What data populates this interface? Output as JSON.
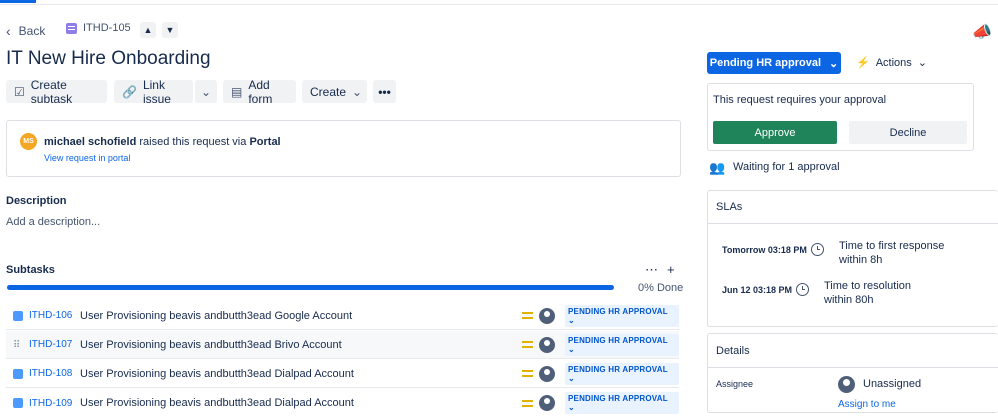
{
  "header": {
    "back_label": "Back",
    "issue_key": "ITHD-105",
    "title": "IT New Hire Onboarding"
  },
  "toolbar": {
    "create_subtask": "Create subtask",
    "link_issue": "Link issue",
    "add_form": "Add form",
    "create": "Create"
  },
  "request": {
    "reporter": "michael schofield",
    "reporter_initials": "MS",
    "raised_text": "raised this request via",
    "channel": "Portal",
    "view_link": "View request in portal"
  },
  "description": {
    "heading": "Description",
    "placeholder": "Add a description..."
  },
  "subtasks": {
    "heading": "Subtasks",
    "progress_percent": 0,
    "progress_label": "0% Done",
    "items": [
      {
        "key": "ITHD-106",
        "summary": "User Provisioning beavis andbutth3ead Google Account",
        "status": "PENDING HR APPROVAL"
      },
      {
        "key": "ITHD-107",
        "summary": "User Provisioning beavis andbutth3ead Brivo Account",
        "status": "PENDING HR APPROVAL"
      },
      {
        "key": "ITHD-108",
        "summary": "User Provisioning beavis andbutth3ead Dialpad Account",
        "status": "PENDING HR APPROVAL"
      },
      {
        "key": "ITHD-109",
        "summary": "User Provisioning beavis andbutth3ead Dialpad Account",
        "status": "PENDING HR APPROVAL"
      }
    ]
  },
  "sidebar": {
    "status_button": "Pending HR approval",
    "actions_label": "Actions",
    "approval_prompt": "This request requires your approval",
    "approve_label": "Approve",
    "decline_label": "Decline",
    "waiting_text": "Waiting for 1 approval",
    "sla_heading": "SLAs",
    "slas": [
      {
        "date": "Tomorrow 03:18 PM",
        "line1": "Time to first response",
        "line2": "within 8h"
      },
      {
        "date": "Jun 12 03:18 PM",
        "line1": "Time to resolution",
        "line2": "within 80h"
      }
    ],
    "details_heading": "Details",
    "assignee_label": "Assignee",
    "assignee_value": "Unassigned",
    "assign_to_me": "Assign to me"
  },
  "colors": {
    "primary": "#0c66e4",
    "approve": "#1f845a",
    "priority": "#e2b203",
    "issue_type_parent": "#8f7ee7",
    "subtask_icon": "#4c9aff"
  }
}
